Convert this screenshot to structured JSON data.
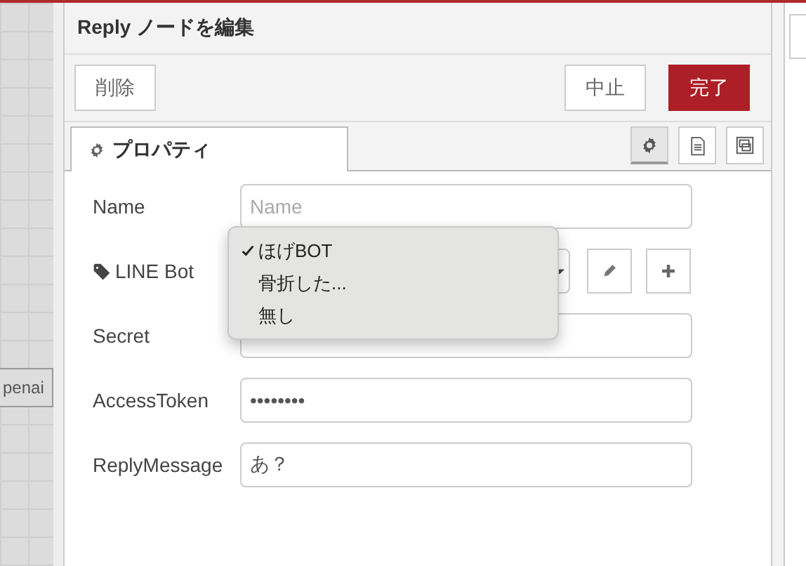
{
  "canvas": {
    "node": {
      "label": "penai"
    }
  },
  "dialog": {
    "title": "Reply ノードを編集",
    "buttons": [
      {
        "label": "削除",
        "kind": "delete"
      },
      {
        "label": "中止",
        "kind": "cancel"
      },
      {
        "label": "完了",
        "kind": "primary"
      }
    ]
  },
  "tabs": [
    {
      "label": "プロパティ",
      "selected": true
    }
  ],
  "tab_icons": [
    {
      "kind": "settings",
      "selected": true
    },
    {
      "kind": "description",
      "selected": false
    },
    {
      "kind": "appearance",
      "selected": false
    }
  ],
  "fields": [
    {
      "label": "Name",
      "kind": "text",
      "placeholder": "Name"
    },
    {
      "label": "LINE Bot",
      "kind": "config"
    },
    {
      "label": "Secret",
      "kind": "text"
    },
    {
      "label": "AccessToken",
      "kind": "text",
      "value": "••••••••"
    },
    {
      "label": "ReplyMessage",
      "kind": "text",
      "value": "あ？"
    }
  ],
  "dropdown": {
    "options": [
      {
        "label": "ほげBOT",
        "selected": true
      },
      {
        "label": "骨折した...",
        "selected": false
      },
      {
        "label": "無し",
        "selected": false
      }
    ]
  }
}
